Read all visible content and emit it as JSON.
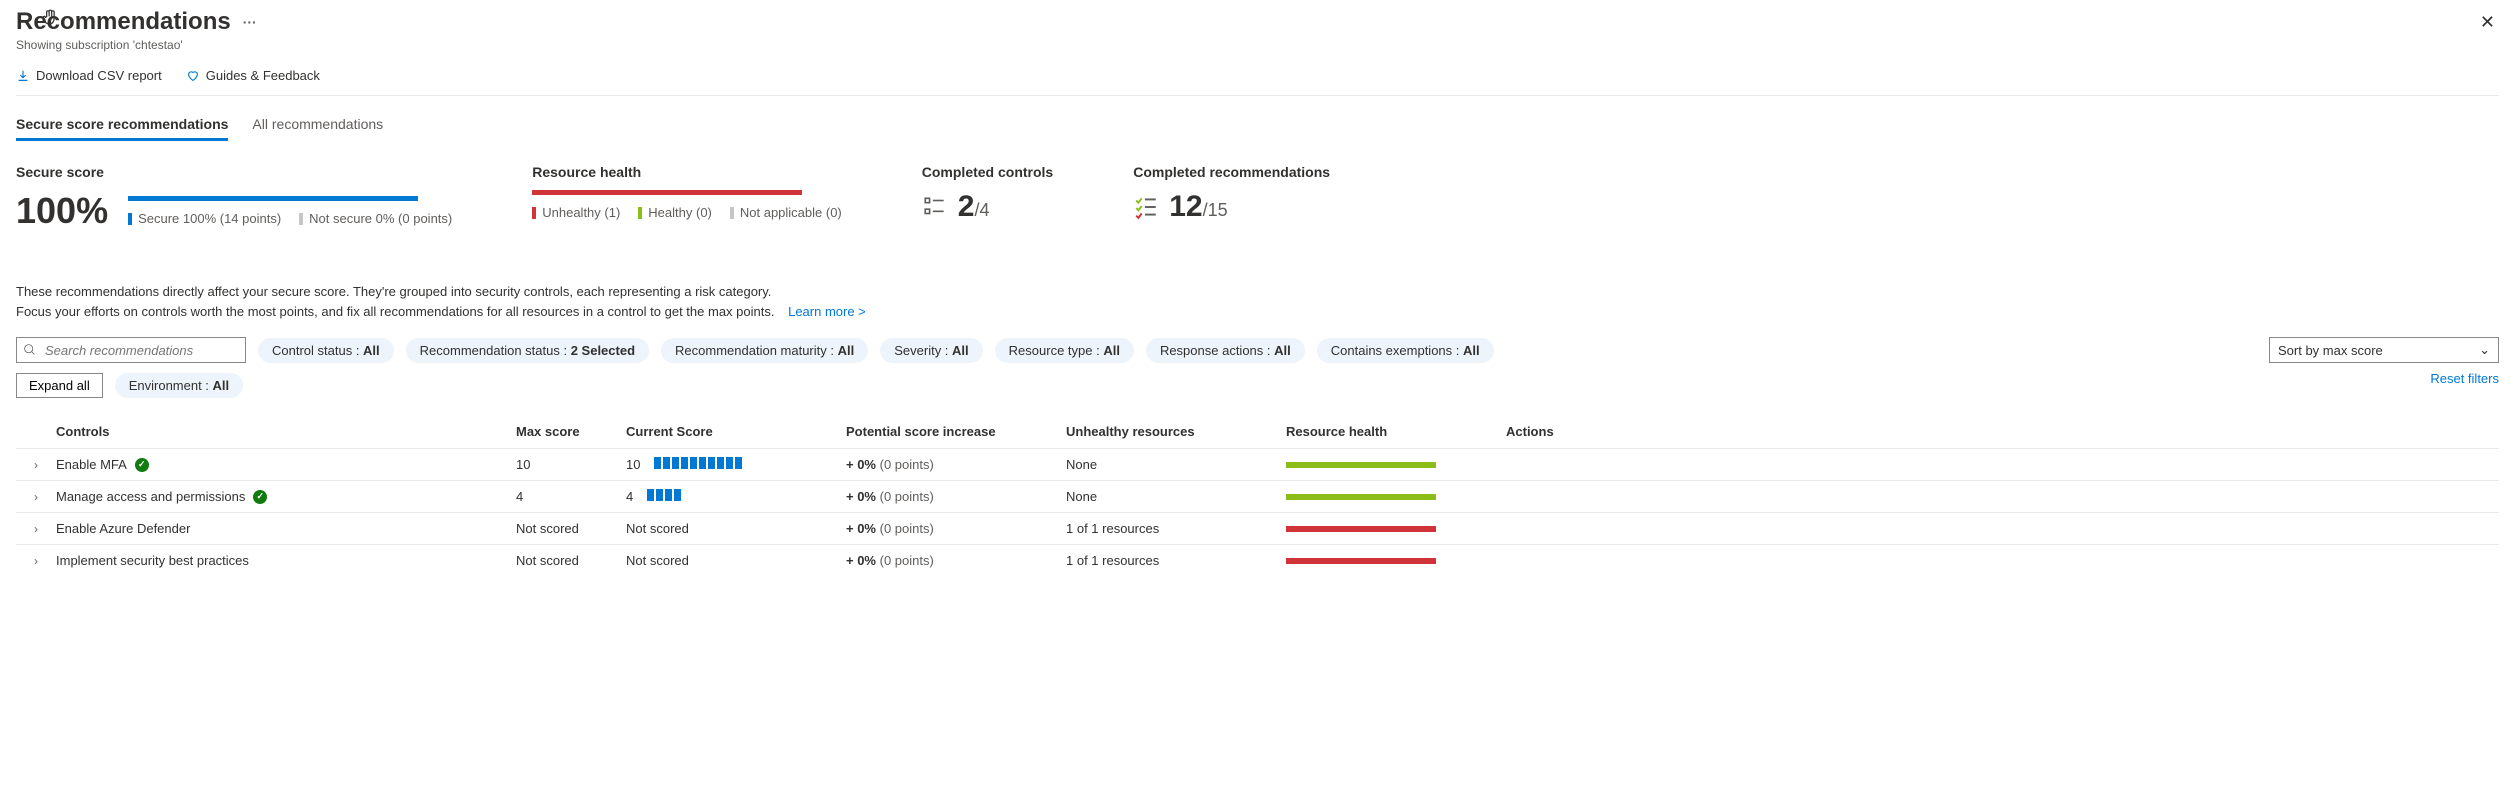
{
  "header": {
    "title": "Recommendations",
    "subtitle": "Showing subscription 'chtestao'"
  },
  "toolbar": {
    "download": "Download CSV report",
    "guides": "Guides & Feedback"
  },
  "tabs": {
    "secure": "Secure score recommendations",
    "all": "All recommendations"
  },
  "stats": {
    "secure_score_label": "Secure score",
    "secure_score_value": "100%",
    "secure_legend": "Secure 100% (14 points)",
    "notsecure_legend": "Not secure 0% (0 points)",
    "resource_health_label": "Resource health",
    "unhealthy": "Unhealthy (1)",
    "healthy": "Healthy (0)",
    "na": "Not applicable (0)",
    "completed_controls_label": "Completed controls",
    "completed_controls_num": "2",
    "completed_controls_den": "/4",
    "completed_recs_label": "Completed recommendations",
    "completed_recs_num": "12",
    "completed_recs_den": "/15"
  },
  "description": {
    "line1": "These recommendations directly affect your secure score. They're grouped into security controls, each representing a risk category.",
    "line2": "Focus your efforts on controls worth the most points, and fix all recommendations for all resources in a control to get the max points.",
    "learn_more": "Learn more >"
  },
  "filters": {
    "search_placeholder": "Search recommendations",
    "control_status": {
      "label": "Control status : ",
      "value": "All"
    },
    "rec_status": {
      "label": "Recommendation status : ",
      "value": "2 Selected"
    },
    "maturity": {
      "label": "Recommendation maturity : ",
      "value": "All"
    },
    "severity": {
      "label": "Severity : ",
      "value": "All"
    },
    "resource_type": {
      "label": "Resource type : ",
      "value": "All"
    },
    "response": {
      "label": "Response actions : ",
      "value": "All"
    },
    "exemptions": {
      "label": "Contains exemptions : ",
      "value": "All"
    },
    "environment": {
      "label": "Environment : ",
      "value": "All"
    },
    "sort": "Sort by max score",
    "expand": "Expand all",
    "reset": "Reset filters"
  },
  "table": {
    "headers": {
      "controls": "Controls",
      "max": "Max score",
      "current": "Current Score",
      "potential": "Potential score increase",
      "unhealthy": "Unhealthy resources",
      "health": "Resource health",
      "actions": "Actions"
    },
    "rows": [
      {
        "name": "Enable MFA",
        "ok": true,
        "max": "10",
        "current": "10",
        "blocks": 10,
        "increase": "+ 0%",
        "increase_pts": "(0 points)",
        "unhealthy": "None",
        "health": "green"
      },
      {
        "name": "Manage access and permissions",
        "ok": true,
        "max": "4",
        "current": "4",
        "blocks": 4,
        "increase": "+ 0%",
        "increase_pts": "(0 points)",
        "unhealthy": "None",
        "health": "green"
      },
      {
        "name": "Enable Azure Defender",
        "ok": false,
        "max": "Not scored",
        "current": "Not scored",
        "blocks": 0,
        "increase": "+ 0%",
        "increase_pts": "(0 points)",
        "unhealthy": "1 of 1 resources",
        "health": "red"
      },
      {
        "name": "Implement security best practices",
        "ok": false,
        "max": "Not scored",
        "current": "Not scored",
        "blocks": 0,
        "increase": "+ 0%",
        "increase_pts": "(0 points)",
        "unhealthy": "1 of 1 resources",
        "health": "red"
      }
    ]
  }
}
